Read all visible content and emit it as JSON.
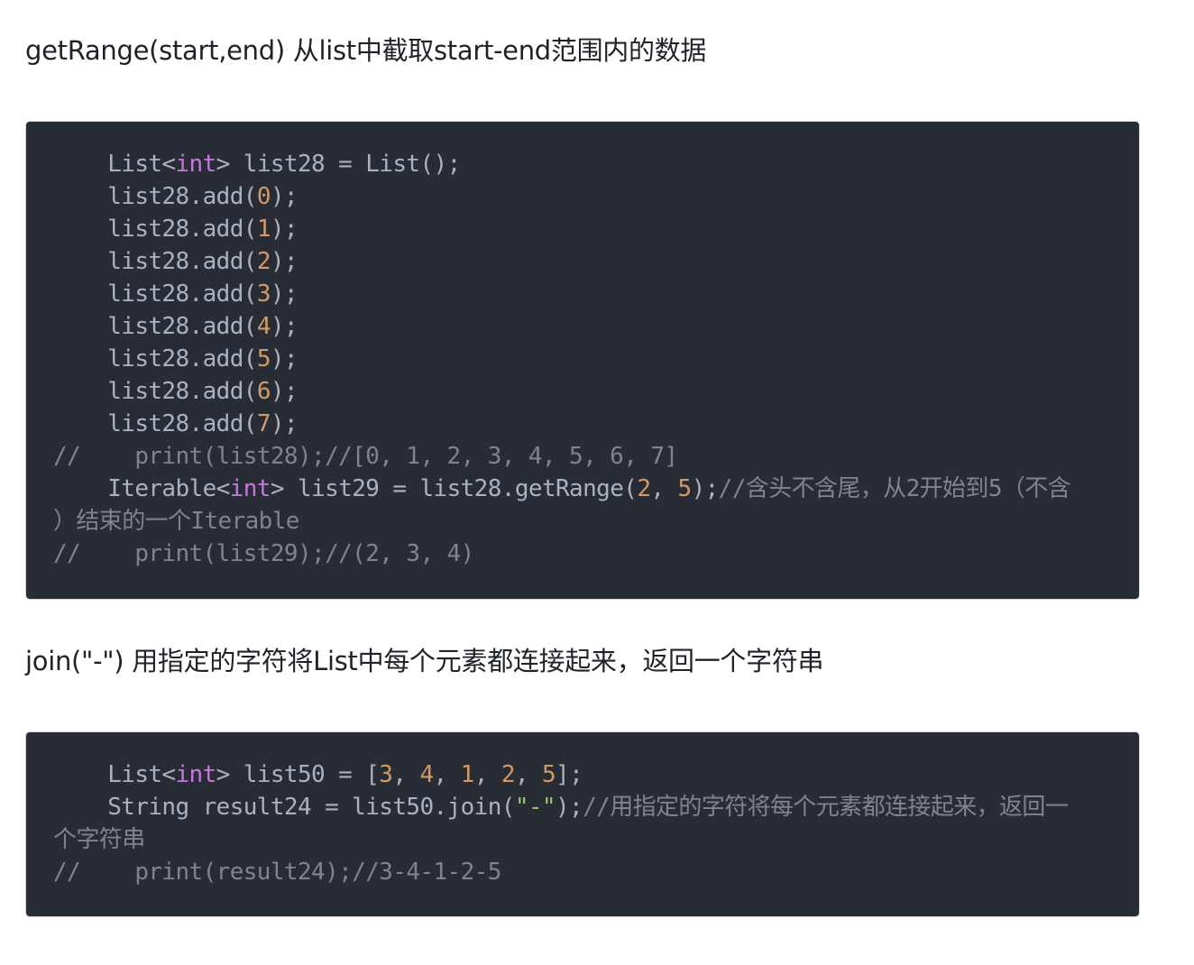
{
  "sections": [
    {
      "heading": "getRange(start,end) 从list中截取start-end范围内的数据",
      "code_lines": [
        [
          {
            "t": "    List<",
            "c": ""
          },
          {
            "t": "int",
            "c": "kw"
          },
          {
            "t": "> list28 = List();",
            "c": ""
          }
        ],
        [
          {
            "t": "    list28.add(",
            "c": ""
          },
          {
            "t": "0",
            "c": "num"
          },
          {
            "t": ");",
            "c": ""
          }
        ],
        [
          {
            "t": "    list28.add(",
            "c": ""
          },
          {
            "t": "1",
            "c": "num"
          },
          {
            "t": ");",
            "c": ""
          }
        ],
        [
          {
            "t": "    list28.add(",
            "c": ""
          },
          {
            "t": "2",
            "c": "num"
          },
          {
            "t": ");",
            "c": ""
          }
        ],
        [
          {
            "t": "    list28.add(",
            "c": ""
          },
          {
            "t": "3",
            "c": "num"
          },
          {
            "t": ");",
            "c": ""
          }
        ],
        [
          {
            "t": "    list28.add(",
            "c": ""
          },
          {
            "t": "4",
            "c": "num"
          },
          {
            "t": ");",
            "c": ""
          }
        ],
        [
          {
            "t": "    list28.add(",
            "c": ""
          },
          {
            "t": "5",
            "c": "num"
          },
          {
            "t": ");",
            "c": ""
          }
        ],
        [
          {
            "t": "    list28.add(",
            "c": ""
          },
          {
            "t": "6",
            "c": "num"
          },
          {
            "t": ");",
            "c": ""
          }
        ],
        [
          {
            "t": "    list28.add(",
            "c": ""
          },
          {
            "t": "7",
            "c": "num"
          },
          {
            "t": ");",
            "c": ""
          }
        ],
        [
          {
            "t": "//    print(list28);//[0, 1, 2, 3, 4, 5, 6, 7]",
            "c": "cmt"
          }
        ],
        [
          {
            "t": "    Iterable<",
            "c": ""
          },
          {
            "t": "int",
            "c": "kw"
          },
          {
            "t": "> list29 = list28.getRange(",
            "c": ""
          },
          {
            "t": "2",
            "c": "num"
          },
          {
            "t": ", ",
            "c": ""
          },
          {
            "t": "5",
            "c": "num"
          },
          {
            "t": ");",
            "c": ""
          },
          {
            "t": "//含头不含尾，从2开始到5（不含",
            "c": "cmt"
          }
        ],
        [
          {
            "t": "）结束的一个Iterable",
            "c": "cmt"
          }
        ],
        [
          {
            "t": "//    print(list29);//(2, 3, 4)",
            "c": "cmt"
          }
        ]
      ]
    },
    {
      "heading": "join(\"-\") 用指定的字符将List中每个元素都连接起来，返回一个字符串",
      "code_lines": [
        [
          {
            "t": "    List<",
            "c": ""
          },
          {
            "t": "int",
            "c": "kw"
          },
          {
            "t": "> list50 = [",
            "c": ""
          },
          {
            "t": "3",
            "c": "num"
          },
          {
            "t": ", ",
            "c": ""
          },
          {
            "t": "4",
            "c": "num"
          },
          {
            "t": ", ",
            "c": ""
          },
          {
            "t": "1",
            "c": "num"
          },
          {
            "t": ", ",
            "c": ""
          },
          {
            "t": "2",
            "c": "num"
          },
          {
            "t": ", ",
            "c": ""
          },
          {
            "t": "5",
            "c": "num"
          },
          {
            "t": "];",
            "c": ""
          }
        ],
        [
          {
            "t": "    String result24 = list50.join(",
            "c": ""
          },
          {
            "t": "\"-\"",
            "c": "str"
          },
          {
            "t": ");",
            "c": ""
          },
          {
            "t": "//用指定的字符将每个元素都连接起来，返回一",
            "c": "cmt"
          }
        ],
        [
          {
            "t": "个字符串",
            "c": "cmt"
          }
        ],
        [
          {
            "t": "//    print(result24);//3-4-1-2-5",
            "c": "cmt"
          }
        ]
      ]
    }
  ],
  "colors": {
    "code_background": "#282c34",
    "code_text": "#abb2bf",
    "keyword": "#c678dd",
    "number": "#d19a66",
    "string": "#98c379",
    "comment": "#7f848e"
  }
}
